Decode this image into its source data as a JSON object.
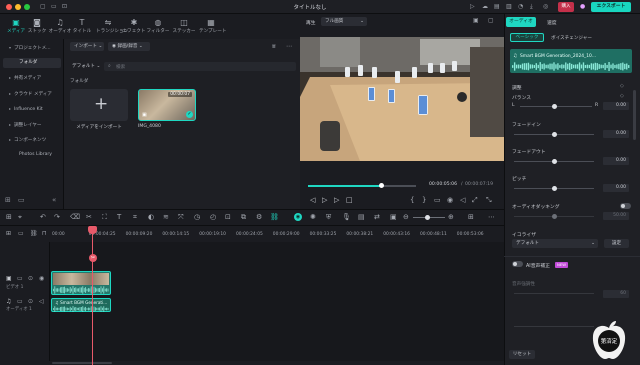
{
  "window": {
    "title": "タイトルなし",
    "buy": "購入",
    "export": "エクスポート"
  },
  "media_toolbar": [
    {
      "label": "メディア",
      "icon": "media-icon",
      "active": true
    },
    {
      "label": "ストック",
      "icon": "stock-icon"
    },
    {
      "label": "オーディオ",
      "icon": "audio-icon"
    },
    {
      "label": "タイトル",
      "icon": "title-icon"
    },
    {
      "label": "トランジション",
      "icon": "transition-icon"
    },
    {
      "label": "エフェクト",
      "icon": "effect-icon"
    },
    {
      "label": "フィルター",
      "icon": "filter-icon"
    },
    {
      "label": "ステッカー",
      "icon": "sticker-icon"
    },
    {
      "label": "テンプレート",
      "icon": "template-icon"
    }
  ],
  "sidebar": {
    "items": [
      {
        "label": "プロジェクトメ...",
        "arrow": true
      },
      {
        "label": "フォルダ",
        "active": true
      },
      {
        "label": "共有メディア",
        "arrow": true
      },
      {
        "label": "クラウド メディア",
        "arrow": true
      },
      {
        "label": "Influence Kit",
        "arrow": true
      },
      {
        "label": "調整レイヤー",
        "arrow": true
      },
      {
        "label": "コンポーネンツ",
        "arrow": true
      },
      {
        "label": "Photos Library"
      }
    ]
  },
  "media": {
    "import_dropdown": "インポート",
    "record_dropdown": "録画/録音",
    "default_dropdown": "デフォルト",
    "search_placeholder": "検索",
    "folder_label": "フォルダ",
    "items": [
      {
        "label": "メディアをインポート"
      },
      {
        "label": "IMG_4080",
        "duration": "00:00:07"
      }
    ]
  },
  "player": {
    "tab_play": "再生",
    "quality": "フル画質",
    "current_time": "00:00:05:06",
    "total_time": "00:00:07:19",
    "progress": 0.68
  },
  "right_panel": {
    "tabs": [
      "オーディオ",
      "速度"
    ],
    "sub_tabs": [
      "ベーシック",
      "ボイスチェンジャー"
    ],
    "clip_name": "Smart BGM Generation_2024_10...",
    "section_adjust": "調整",
    "sliders": [
      {
        "label": "バランス",
        "left": "L",
        "right": "R",
        "value": "0.00"
      },
      {
        "label": "フェードイン",
        "value": "0.00"
      },
      {
        "label": "フェードアウト",
        "value": "0.00"
      },
      {
        "label": "ピッチ",
        "value": "0.00"
      }
    ],
    "ducking_label": "オーディオダッキング",
    "ducking_value": "50.00",
    "equalizer_label": "イコライザ",
    "equalizer_value": "デフォルト",
    "equalizer_button": "設定",
    "ai_denoise_label": "AI音声補正",
    "ai_badge": "NEW",
    "denoise_label": "音声強調性",
    "denoise_value": "60",
    "reset_button": "リセット"
  },
  "timeline": {
    "ticks": [
      "00:00",
      "00:00:04:25",
      "00:00:09:20",
      "00:00:14:15",
      "00:00:19:10",
      "00:00:24:05",
      "00:00:29:00",
      "00:00:33:25",
      "00:00:38:21",
      "00:00:43:16",
      "00:00:48:11",
      "00:00:53:06"
    ],
    "video_track_label": "ビデオ 1",
    "audio_track_label": "オーディオ 1",
    "audio_clip_label": "Smart BGM Generati..."
  },
  "watermark": {
    "text": "第済定"
  },
  "colors": {
    "accent": "#1fd7c2",
    "buy": "#c4304a",
    "playhead": "#e85a6a",
    "video_clip": "#26786c",
    "audio_clip": "#1e6a5c"
  }
}
